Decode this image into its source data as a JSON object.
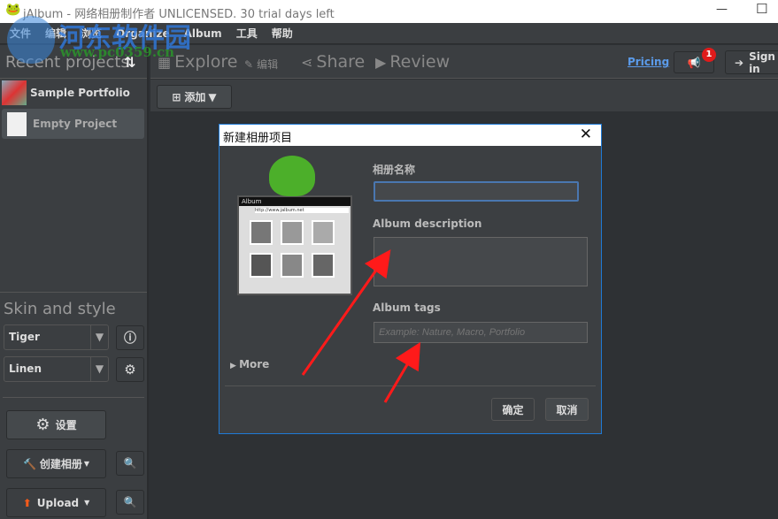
{
  "window": {
    "title": "jAlbum - 网络相册制作者 UNLICENSED. 30 trial days left",
    "minimize": "—",
    "maximize": "☐"
  },
  "watermark": {
    "name": "河东软件园",
    "url": "www.pc0359.cn"
  },
  "menu": [
    "文件",
    "编辑",
    "浏览",
    "Organize",
    "Album",
    "工具",
    "帮助"
  ],
  "sidebar": {
    "recent_title": "Recent projects",
    "sort_icon": "⇅",
    "projects": [
      {
        "name": "Sample Portfolio"
      },
      {
        "name": "Empty Project"
      }
    ],
    "skin_title": "Skin and style",
    "skin": "Tiger",
    "style": "Linen",
    "settings_label": "设置",
    "make_label": "创建相册",
    "upload_label": "Upload"
  },
  "toolbar": {
    "tabs": [
      "Explore",
      "编辑",
      "Share",
      "Review"
    ],
    "pricing": "Pricing",
    "notification_count": "1",
    "sign_in": "Sign in",
    "add_label": "添加"
  },
  "dialog": {
    "title": "新建相册项目",
    "name_label": "相册名称",
    "name_value": "",
    "desc_label": "Album description",
    "tags_label": "Album tags",
    "tags_placeholder": "Example: Nature, Macro, Portfolio",
    "more": "More",
    "ok": "确定",
    "cancel": "取消",
    "illustration": {
      "window_title": "Album",
      "url": "http://www.jalbum.net"
    }
  },
  "colors": {
    "accent": "#1f7ad6",
    "link": "#5b9bea",
    "badge": "#e01b1b",
    "arrow": "#ff1a1a"
  }
}
